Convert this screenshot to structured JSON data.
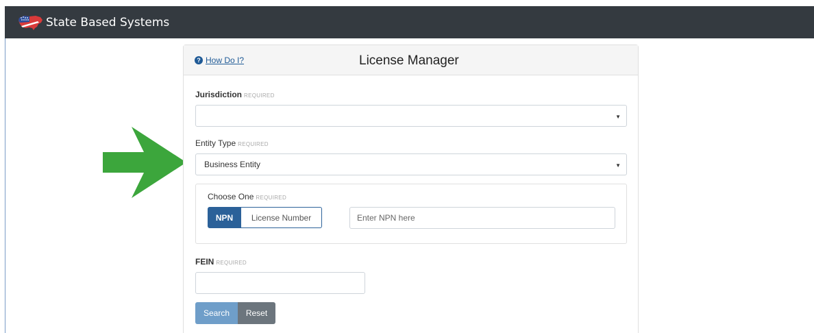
{
  "navbar": {
    "brand_text": "State Based Systems",
    "logo_icon": "us-map-flag-icon"
  },
  "card": {
    "title": "License Manager",
    "help_link": "How Do I?",
    "help_icon": "question-circle-icon"
  },
  "form": {
    "jurisdiction": {
      "label": "Jurisdiction",
      "required": "REQUIRED",
      "value": ""
    },
    "entity_type": {
      "label": "Entity Type",
      "required": "REQUIRED",
      "value": "Business Entity"
    },
    "choose_one": {
      "label": "Choose One",
      "required": "REQUIRED",
      "options": [
        "NPN",
        "License Number"
      ],
      "selected": "NPN",
      "input_placeholder": "Enter NPN here"
    },
    "fein": {
      "label": "FEIN",
      "required": "REQUIRED",
      "value": ""
    },
    "buttons": {
      "search": "Search",
      "reset": "Reset"
    }
  },
  "colors": {
    "navbar": "#343a40",
    "primary": "#2b6199",
    "search_button": "#6f9ec9",
    "reset_button": "#6c757d",
    "arrow": "#3ca63c"
  }
}
